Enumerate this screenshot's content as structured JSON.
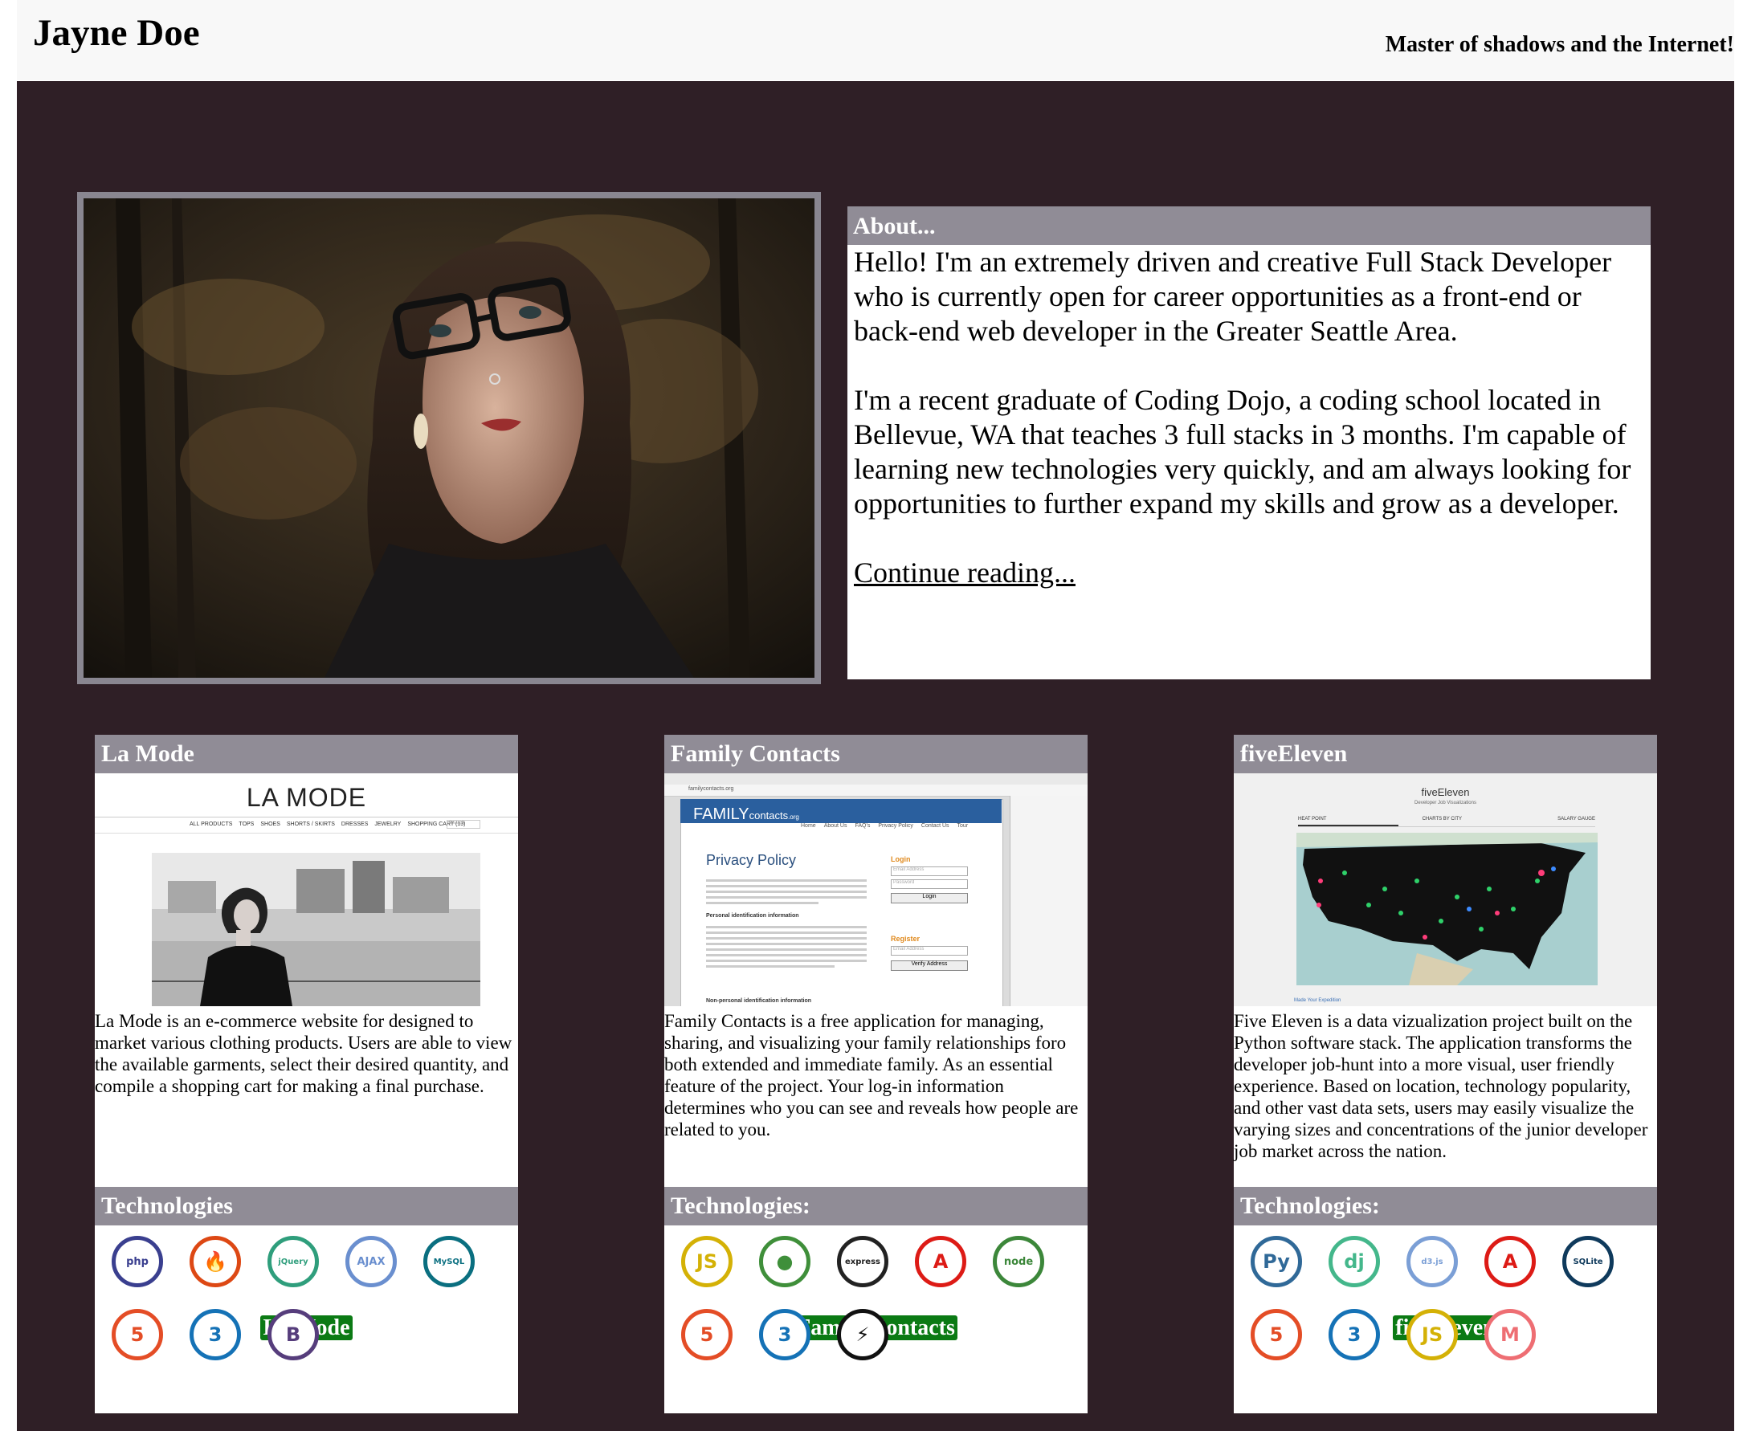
{
  "header": {
    "site_title": "Jayne Doe",
    "tagline": "Master of shadows and the Internet!"
  },
  "about": {
    "heading": "About...",
    "paragraph_1": "Hello! I'm an extremely driven and creative Full Stack Developer who is currently open for career opportunities as a front-end or back-end web developer in the Greater Seattle Area.",
    "paragraph_2": "I'm a recent graduate of Coding Dojo, a coding school located in Bellevue, WA that teaches 3 full stacks in 3 months. I'm capable of learning new technologies very quickly, and am always looking for opportunities to further expand my skills and grow as a developer.",
    "link_text": "Continue reading..."
  },
  "projects": [
    {
      "title": "La Mode",
      "description": "La Mode is an e-commerce website for designed to market various clothing products. Users are able to view the available garments, select their desired quantity, and compile a shopping cart for making a final purchase.",
      "tech_heading": "Technologies",
      "badge": "La Mode",
      "shot": {
        "logo": "LA MODE",
        "nav": [
          "ALL PRODUCTS",
          "TOPS",
          "SHOES",
          "SHORTS / SKIRTS",
          "DRESSES",
          "JEWELRY",
          "SHOPPING CART (13)"
        ],
        "search": "Search"
      },
      "icons": [
        {
          "name": "php-icon",
          "glyph": "php",
          "color": "#3a3f8f"
        },
        {
          "name": "codeigniter-icon",
          "glyph": "🔥",
          "color": "#dd4814"
        },
        {
          "name": "jquery-icon",
          "glyph": "jQuery",
          "color": "#2f9e7c"
        },
        {
          "name": "ajax-icon",
          "glyph": "AJAX",
          "color": "#6a8fcf"
        },
        {
          "name": "mysql-icon",
          "glyph": "MySQL",
          "color": "#0a6f80"
        },
        {
          "name": "html5-icon",
          "glyph": "5",
          "color": "#e44d26"
        },
        {
          "name": "css3-icon",
          "glyph": "3",
          "color": "#1572b6"
        },
        {
          "name": "bootstrap-icon",
          "glyph": "B",
          "color": "#563d7c"
        }
      ]
    },
    {
      "title": "Family Contacts",
      "description": "Family Contacts is a free application for managing, sharing, and visualizing your family relationships foro both extended and immediate family. As an essential feature of the project. Your log-in information determines who you can see and reveals how people are related to you.",
      "tech_heading": "Technologies:",
      "badge": "Family Contacts",
      "shot": {
        "brand": "FAMILY",
        "brand_sub": "contacts",
        "brand_tld": ".org",
        "nav": [
          "Home",
          "About Us",
          "FAQ's",
          "Privacy Policy",
          "Contact Us",
          "Tour"
        ],
        "page_title": "Privacy Policy",
        "login_heading": "Login",
        "email_placeholder": "Email Address",
        "password_placeholder": "Password",
        "login_button": "Login",
        "register_heading": "Register",
        "register_email_placeholder": "Email Address",
        "verify_button": "Verify Address",
        "section_1": "Personal identification information",
        "section_2": "Non-personal identification information",
        "url": "familycontacts.org"
      },
      "icons": [
        {
          "name": "javascript-icon",
          "glyph": "JS",
          "color": "#d4b106"
        },
        {
          "name": "mongodb-icon",
          "glyph": "●",
          "color": "#3f8f3a"
        },
        {
          "name": "express-icon",
          "glyph": "express",
          "color": "#222222"
        },
        {
          "name": "angular-icon",
          "glyph": "A",
          "color": "#dd1b16"
        },
        {
          "name": "node-icon",
          "glyph": "node",
          "color": "#3c873a"
        },
        {
          "name": "html5-icon",
          "glyph": "5",
          "color": "#e44d26"
        },
        {
          "name": "css3-icon",
          "glyph": "3",
          "color": "#1572b6"
        },
        {
          "name": "socketio-icon",
          "glyph": "⚡",
          "color": "#111111"
        }
      ]
    },
    {
      "title": "fiveEleven",
      "description": "Five Eleven is a data vizualization project built on the Python software stack. The application transforms the developer job-hunt into a more visual, user friendly experience. Based on location, technology popularity, and other vast data sets, users may easily visualize the varying sizes and concentrations of the junior developer job market across the nation.",
      "tech_heading": "Technologies:",
      "badge": "fiveEleven",
      "shot": {
        "title": "fiveEleven",
        "subtitle": "Developer Job Visualizations",
        "tabs": [
          "HEAT POINT",
          "CHARTS BY CITY",
          "SALARY GAUGE"
        ],
        "footer": "Made Your Expedition"
      },
      "icons": [
        {
          "name": "python-icon",
          "glyph": "Py",
          "color": "#306998"
        },
        {
          "name": "django-icon",
          "glyph": "dj",
          "color": "#44b78b"
        },
        {
          "name": "d3js-icon",
          "glyph": "d3.js",
          "color": "#7b9fd6"
        },
        {
          "name": "angular-icon",
          "glyph": "A",
          "color": "#dd1b16"
        },
        {
          "name": "sqlite-icon",
          "glyph": "SQLite",
          "color": "#0f3a5c"
        },
        {
          "name": "html5-icon",
          "glyph": "5",
          "color": "#e44d26"
        },
        {
          "name": "css3-icon",
          "glyph": "3",
          "color": "#1572b6"
        },
        {
          "name": "javascript-icon",
          "glyph": "JS",
          "color": "#d4b106"
        },
        {
          "name": "materialize-icon",
          "glyph": "M",
          "color": "#ee6e73"
        }
      ]
    }
  ]
}
